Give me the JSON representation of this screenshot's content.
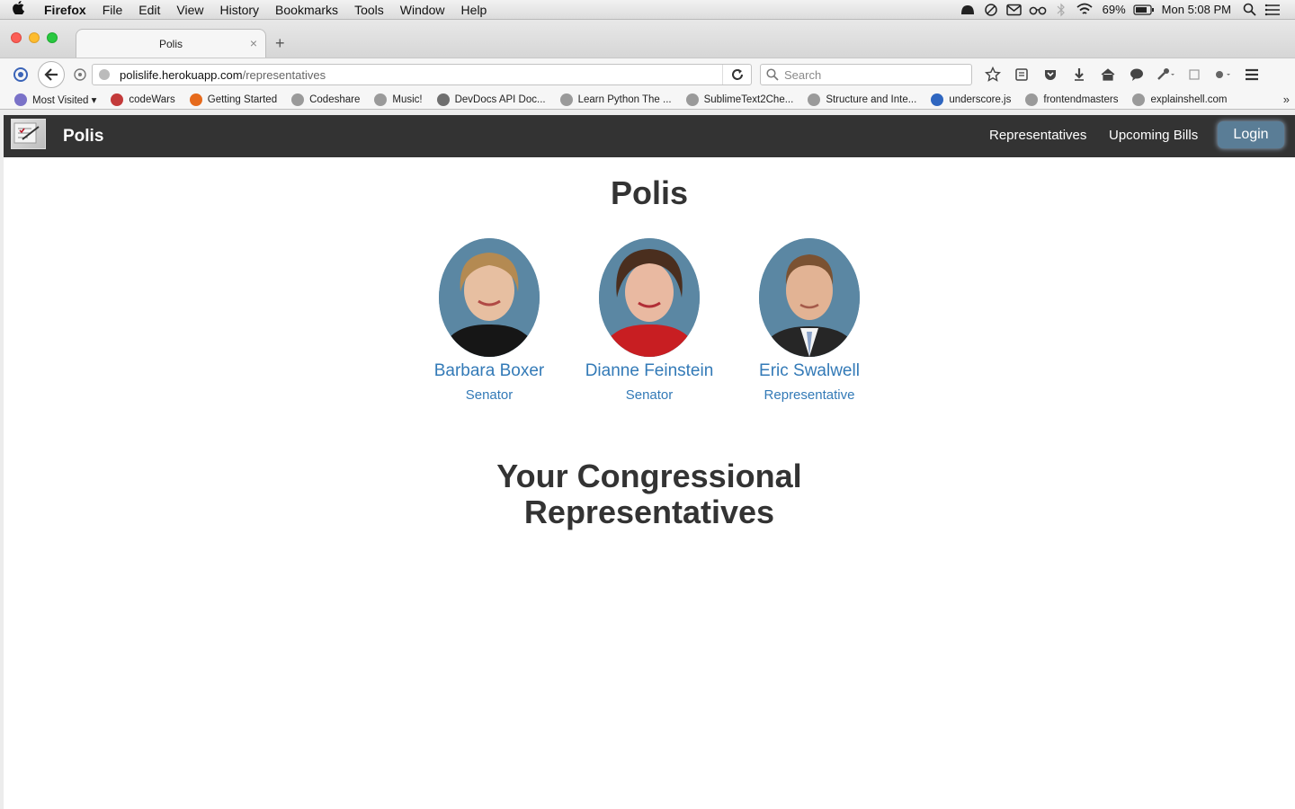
{
  "menubar": {
    "apple": "",
    "items": [
      "Firefox",
      "File",
      "Edit",
      "View",
      "History",
      "Bookmarks",
      "Tools",
      "Window",
      "Help"
    ],
    "battery": "69%",
    "clock": "Mon 5:08 PM"
  },
  "browser": {
    "tab_title": "Polis",
    "tab_close": "×",
    "new_tab": "+",
    "url_host": "polislife.herokuapp.com",
    "url_path": "/representatives",
    "search_placeholder": "Search",
    "bookmarks": [
      {
        "label": "Most Visited ▾",
        "color": "#7a72c8"
      },
      {
        "label": "codeWars",
        "color": "#c33a3a"
      },
      {
        "label": "Getting Started",
        "color": "#e66a1c"
      },
      {
        "label": "Codeshare",
        "color": "#9a9a9a"
      },
      {
        "label": "Music!",
        "color": "#9a9a9a"
      },
      {
        "label": "DevDocs API Doc...",
        "color": "#6f6f6f"
      },
      {
        "label": "Learn Python The ...",
        "color": "#9a9a9a"
      },
      {
        "label": "SublimeText2Che...",
        "color": "#9a9a9a"
      },
      {
        "label": "Structure and Inte...",
        "color": "#9a9a9a"
      },
      {
        "label": "underscore.js",
        "color": "#2f66c0"
      },
      {
        "label": "frontendmasters",
        "color": "#9a9a9a"
      },
      {
        "label": "explainshell.com",
        "color": "#9a9a9a"
      }
    ],
    "bookmarks_more": "»"
  },
  "site": {
    "brand": "Polis",
    "nav": {
      "representatives": "Representatives",
      "upcoming_bills": "Upcoming Bills",
      "login": "Login"
    },
    "title": "Polis",
    "representatives": [
      {
        "name": "Barbara Boxer",
        "role": "Senator",
        "hair": "#b48a52",
        "top": "#161616"
      },
      {
        "name": "Dianne Feinstein",
        "role": "Senator",
        "hair": "#4a2e1e",
        "top": "#c81e22"
      },
      {
        "name": "Eric Swalwell",
        "role": "Representative",
        "hair": "#7b5232",
        "top": "#262626"
      }
    ],
    "subtitle_line1": "Your Congressional",
    "subtitle_line2": "Representatives"
  }
}
